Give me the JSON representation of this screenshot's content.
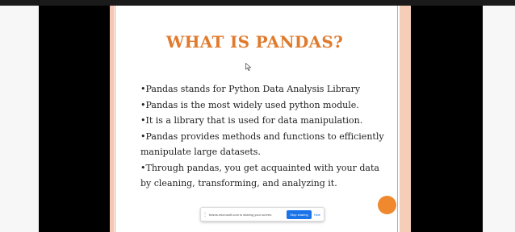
{
  "slide": {
    "title": "WHAT IS PANDAS?",
    "lines": [
      "•Pandas stands for Python Data Analysis Library",
      "•Pandas is the most widely used python module.",
      "•It is a library that is used for data manipulation.",
      "•Pandas provides methods and functions to efficiently",
      "manipulate large datasets.",
      "•Through pandas, you get acquainted with your data",
      "by cleaning, transforming, and analyzing it."
    ]
  },
  "share_bar": {
    "message": "teams.microsoft.com is sharing your screen.",
    "stop_label": "Stop sharing",
    "hide_label": "Hide"
  },
  "colors": {
    "title": "#e07a2c",
    "accent_border": "#f6cdb7",
    "stop_button": "#1a73e8",
    "orange_button": "#f0882d"
  }
}
